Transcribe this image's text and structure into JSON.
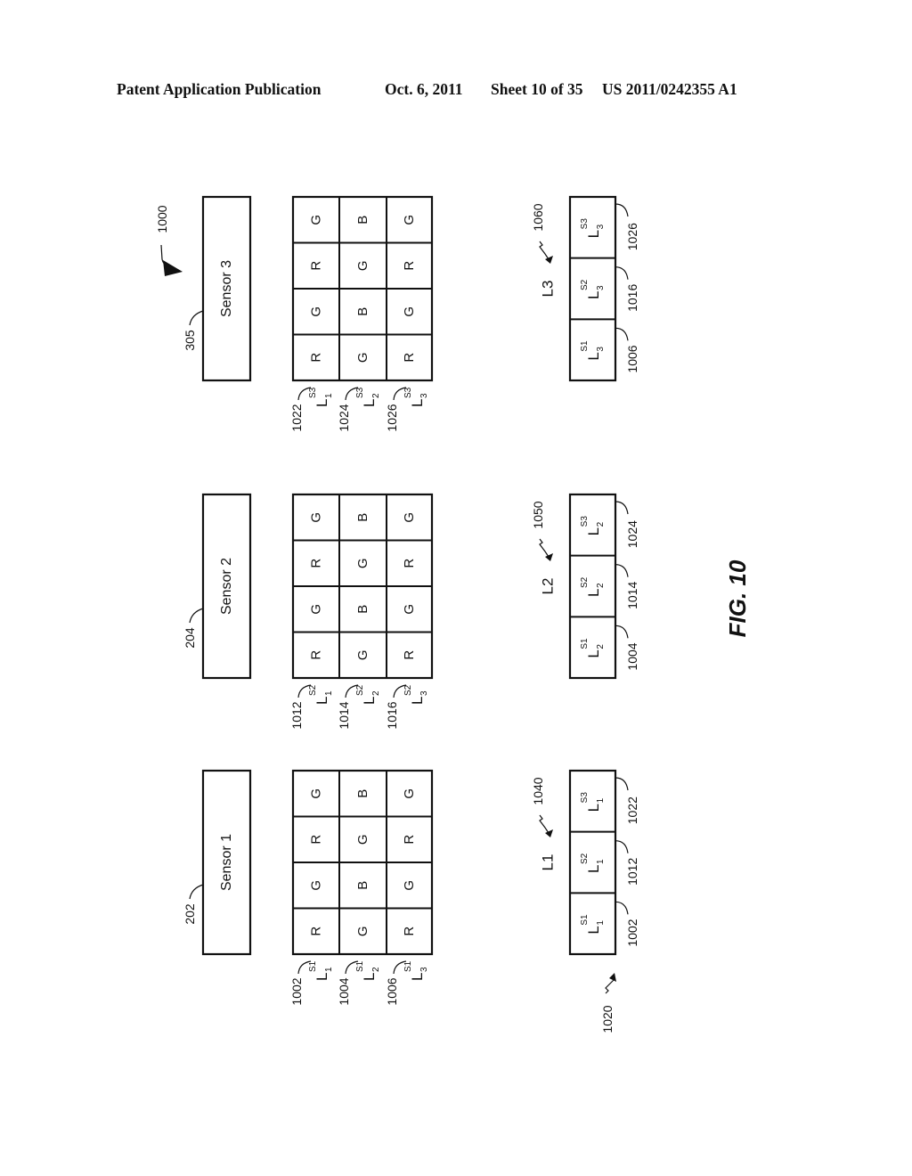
{
  "header": {
    "publication": "Patent Application Publication",
    "date": "Oct. 6, 2011",
    "sheet": "Sheet 10 of 35",
    "number": "US 2011/0242355 A1"
  },
  "figure": {
    "label": "FIG. 10",
    "ref": "1000",
    "input_ref": "1020",
    "sensors": [
      {
        "name": "Sensor 3",
        "ref": "305",
        "grid": [
          [
            "R",
            "G",
            "R",
            "G"
          ],
          [
            "G",
            "B",
            "G",
            "B"
          ],
          [
            "R",
            "G",
            "R",
            "G"
          ]
        ],
        "lines": [
          {
            "base": "L",
            "sub": "1",
            "sup": "S3",
            "ref": "1022"
          },
          {
            "base": "L",
            "sub": "2",
            "sup": "S3",
            "ref": "1024"
          },
          {
            "base": "L",
            "sub": "3",
            "sup": "S3",
            "ref": "1026"
          }
        ]
      },
      {
        "name": "Sensor 2",
        "ref": "204",
        "grid": [
          [
            "R",
            "G",
            "R",
            "G"
          ],
          [
            "G",
            "B",
            "G",
            "B"
          ],
          [
            "R",
            "G",
            "R",
            "G"
          ]
        ],
        "lines": [
          {
            "base": "L",
            "sub": "1",
            "sup": "S2",
            "ref": "1012"
          },
          {
            "base": "L",
            "sub": "2",
            "sup": "S2",
            "ref": "1014"
          },
          {
            "base": "L",
            "sub": "3",
            "sup": "S2",
            "ref": "1016"
          }
        ]
      },
      {
        "name": "Sensor 1",
        "ref": "202",
        "grid": [
          [
            "R",
            "G",
            "R",
            "G"
          ],
          [
            "G",
            "B",
            "G",
            "B"
          ],
          [
            "R",
            "G",
            "R",
            "G"
          ]
        ],
        "lines": [
          {
            "base": "L",
            "sub": "1",
            "sup": "S1",
            "ref": "1002"
          },
          {
            "base": "L",
            "sub": "2",
            "sup": "S1",
            "ref": "1004"
          },
          {
            "base": "L",
            "sub": "3",
            "sup": "S1",
            "ref": "1006"
          }
        ]
      }
    ],
    "combined": [
      {
        "name": "L3",
        "ref": "1060",
        "cells": [
          {
            "base": "L",
            "sub": "3",
            "sup": "S1",
            "ref": "1006"
          },
          {
            "base": "L",
            "sub": "3",
            "sup": "S2",
            "ref": "1016"
          },
          {
            "base": "L",
            "sub": "3",
            "sup": "S3",
            "ref": "1026"
          }
        ]
      },
      {
        "name": "L2",
        "ref": "1050",
        "cells": [
          {
            "base": "L",
            "sub": "2",
            "sup": "S1",
            "ref": "1004"
          },
          {
            "base": "L",
            "sub": "2",
            "sup": "S2",
            "ref": "1014"
          },
          {
            "base": "L",
            "sub": "2",
            "sup": "S3",
            "ref": "1024"
          }
        ]
      },
      {
        "name": "L1",
        "ref": "1040",
        "cells": [
          {
            "base": "L",
            "sub": "1",
            "sup": "S1",
            "ref": "1002"
          },
          {
            "base": "L",
            "sub": "1",
            "sup": "S2",
            "ref": "1012"
          },
          {
            "base": "L",
            "sub": "1",
            "sup": "S3",
            "ref": "1022"
          }
        ]
      }
    ]
  }
}
